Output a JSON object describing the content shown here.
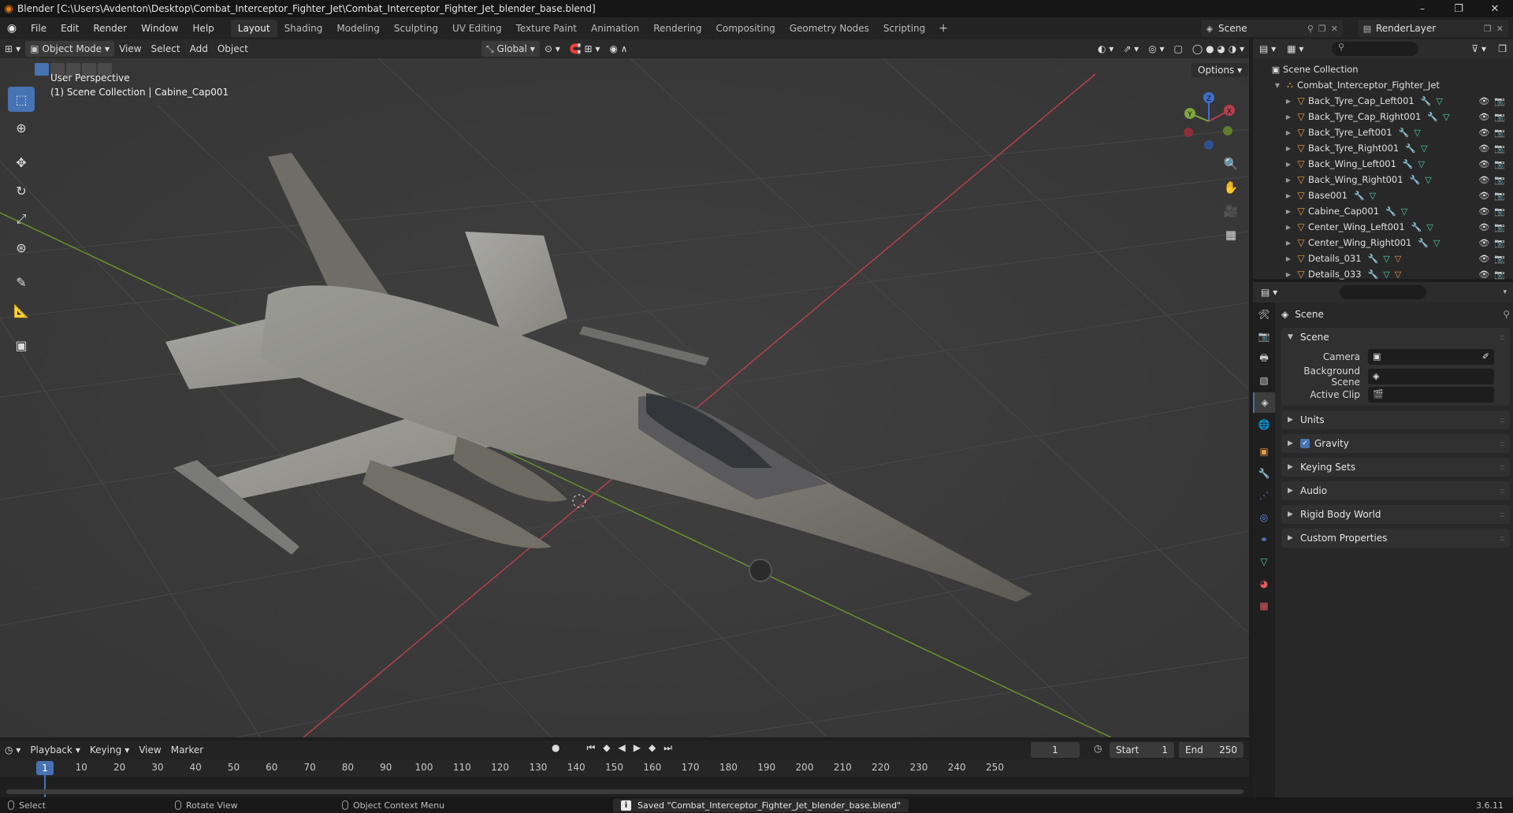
{
  "window": {
    "title": "Blender [C:\\Users\\Avdenton\\Desktop\\Combat_Interceptor_Fighter_Jet\\Combat_Interceptor_Fighter_Jet_blender_base.blend]",
    "controls": [
      "–",
      "❐",
      "✕"
    ]
  },
  "menu": [
    "File",
    "Edit",
    "Render",
    "Window",
    "Help"
  ],
  "workspaces": [
    "Layout",
    "Shading",
    "Modeling",
    "Sculpting",
    "UV Editing",
    "Texture Paint",
    "Animation",
    "Rendering",
    "Compositing",
    "Geometry Nodes",
    "Scripting"
  ],
  "active_workspace": "Layout",
  "scene_selector": "Scene",
  "renderlayer_selector": "RenderLayer",
  "viewport_header": {
    "mode": "Object Mode",
    "menus": [
      "View",
      "Select",
      "Add",
      "Object"
    ],
    "transform_orientation": "Global",
    "options": "Options"
  },
  "viewport": {
    "perspective": "User Perspective",
    "collection_info": "(1) Scene Collection | Cabine_Cap001",
    "gizmo_axes": [
      "X",
      "Y",
      "Z"
    ],
    "tools": [
      "select-box-icon",
      "cursor-icon",
      "move-icon",
      "rotate-icon",
      "scale-icon",
      "transform-icon",
      "annotate-icon",
      "measure-icon",
      "add-cube-icon"
    ]
  },
  "timeline": {
    "menus": [
      "Playback",
      "Keying",
      "View",
      "Marker"
    ],
    "current_frame": "1",
    "start_label": "Start",
    "start": "1",
    "end_label": "End",
    "end": "250",
    "ruler": [
      "10",
      "20",
      "30",
      "40",
      "50",
      "60",
      "70",
      "80",
      "90",
      "100",
      "110",
      "120",
      "130",
      "140",
      "150",
      "160",
      "170",
      "180",
      "190",
      "200",
      "210",
      "220",
      "230",
      "240",
      "250"
    ]
  },
  "statusbar": {
    "select": "Select",
    "rotate": "Rotate View",
    "context": "Object Context Menu",
    "message": "Saved \"Combat_Interceptor_Fighter_Jet_blender_base.blend\"",
    "version": "3.6.11"
  },
  "outliner": {
    "root": "Scene Collection",
    "collection": "Combat_Interceptor_Fighter_Jet",
    "items": [
      {
        "name": "Back_Tyre_Cap_Left001",
        "mods": [
          "wrench",
          "mesh"
        ]
      },
      {
        "name": "Back_Tyre_Cap_Right001",
        "mods": [
          "wrench",
          "mesh"
        ]
      },
      {
        "name": "Back_Tyre_Left001",
        "mods": [
          "wrench",
          "mesh"
        ]
      },
      {
        "name": "Back_Tyre_Right001",
        "mods": [
          "wrench",
          "mesh"
        ]
      },
      {
        "name": "Back_Wing_Left001",
        "mods": [
          "wrench",
          "mesh"
        ]
      },
      {
        "name": "Back_Wing_Right001",
        "mods": [
          "wrench",
          "mesh"
        ]
      },
      {
        "name": "Base001",
        "mods": [
          "wrench",
          "mesh"
        ]
      },
      {
        "name": "Cabine_Cap001",
        "mods": [
          "wrench",
          "mesh"
        ]
      },
      {
        "name": "Center_Wing_Left001",
        "mods": [
          "wrench",
          "mesh"
        ]
      },
      {
        "name": "Center_Wing_Right001",
        "mods": [
          "wrench",
          "mesh"
        ]
      },
      {
        "name": "Details_031",
        "mods": [
          "wrench",
          "mesh",
          "material"
        ]
      },
      {
        "name": "Details_033",
        "mods": [
          "wrench",
          "mesh",
          "material"
        ]
      }
    ]
  },
  "properties": {
    "breadcrumb": "Scene",
    "panel_scene": "Scene",
    "camera_label": "Camera",
    "background_scene_label": "Background Scene",
    "active_clip_label": "Active Clip",
    "panels": [
      "Units",
      "Gravity",
      "Keying Sets",
      "Audio",
      "Rigid Body World",
      "Custom Properties"
    ]
  },
  "colors": {
    "accent": "#4772b3",
    "x_axis": "#b63f4e",
    "y_axis": "#7da53a",
    "z_axis": "#3f6fc9"
  }
}
